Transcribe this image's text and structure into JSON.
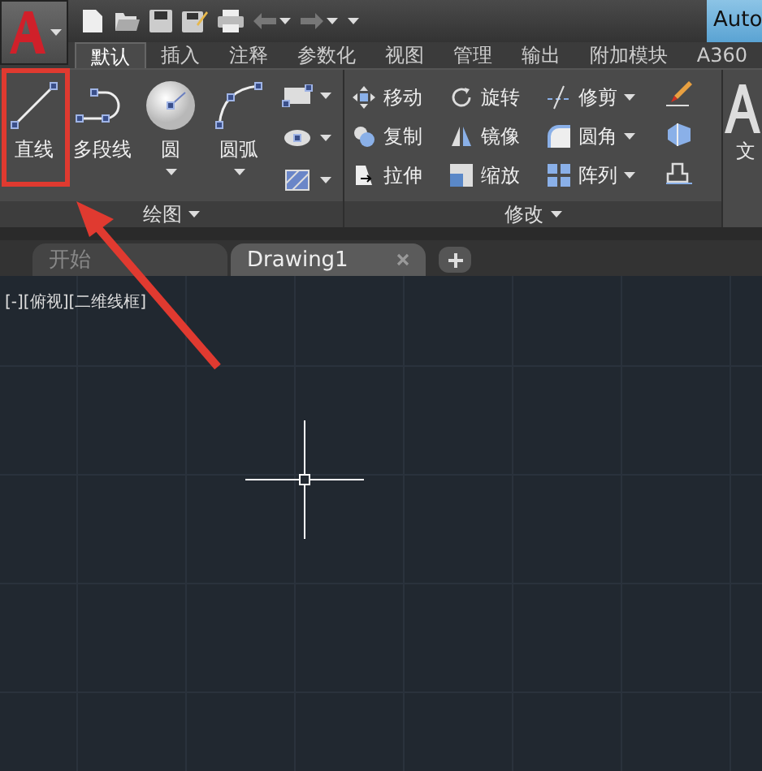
{
  "window": {
    "title": "Auto"
  },
  "ribbon_tabs": [
    {
      "label": "默认",
      "selected": true
    },
    {
      "label": "插入",
      "selected": false
    },
    {
      "label": "注释",
      "selected": false
    },
    {
      "label": "参数化",
      "selected": false
    },
    {
      "label": "视图",
      "selected": false
    },
    {
      "label": "管理",
      "selected": false
    },
    {
      "label": "输出",
      "selected": false
    },
    {
      "label": "附加模块",
      "selected": false
    },
    {
      "label": "A360",
      "selected": false
    }
  ],
  "draw_panel": {
    "title": "绘图",
    "tools": [
      {
        "label": "直线",
        "kind": "line",
        "dropdown": false
      },
      {
        "label": "多段线",
        "kind": "polyline",
        "dropdown": false
      },
      {
        "label": "圆",
        "kind": "circle",
        "dropdown": true
      },
      {
        "label": "圆弧",
        "kind": "arc",
        "dropdown": true
      }
    ]
  },
  "modify_panel": {
    "title": "修改",
    "tools": [
      {
        "label": "移动",
        "kind": "move",
        "dropdown": false
      },
      {
        "label": "复制",
        "kind": "copy",
        "dropdown": false
      },
      {
        "label": "拉伸",
        "kind": "stretch",
        "dropdown": false
      },
      {
        "label": "旋转",
        "kind": "rotate",
        "dropdown": false
      },
      {
        "label": "镜像",
        "kind": "mirror",
        "dropdown": false
      },
      {
        "label": "缩放",
        "kind": "scale",
        "dropdown": false
      },
      {
        "label": "修剪",
        "kind": "trim",
        "dropdown": true
      },
      {
        "label": "圆角",
        "kind": "fillet",
        "dropdown": true
      },
      {
        "label": "阵列",
        "kind": "array",
        "dropdown": true
      }
    ]
  },
  "annotation_panel": {
    "label": "文"
  },
  "file_tabs": [
    {
      "label": "开始",
      "selected": false,
      "closable": false
    },
    {
      "label": "Drawing1",
      "selected": true,
      "closable": true
    }
  ],
  "viewport": {
    "label": "[-][俯视][二维线框]"
  }
}
